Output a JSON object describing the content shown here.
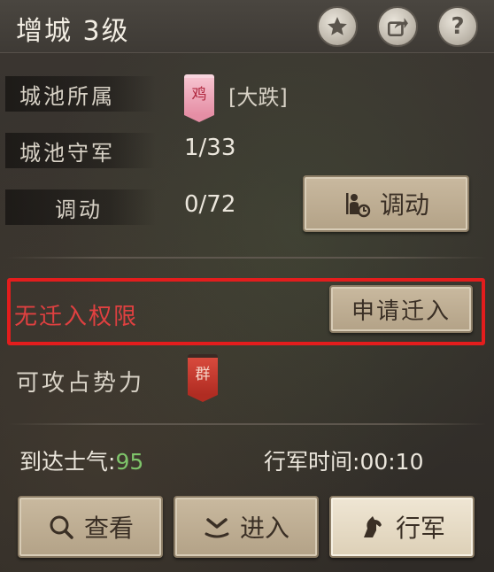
{
  "header": {
    "title": "增城  3级",
    "help_label": "?"
  },
  "rows": {
    "owner_label": "城池所属",
    "owner_flag": "鸡",
    "owner_name": "[大跌]",
    "garrison_label": "城池守军",
    "garrison_value": "1/33",
    "transfer_label": "调动",
    "transfer_value": "0/72",
    "transfer_button": "调动"
  },
  "permission": {
    "status": "无迁入权限",
    "apply_button": "申请迁入"
  },
  "attack": {
    "label": "可攻占势力",
    "flag": "群"
  },
  "stats": {
    "morale_label": "到达士气:",
    "morale_value": "95",
    "march_time_label": "行军时间:",
    "march_time_value": "00:10"
  },
  "actions": {
    "view": "查看",
    "enter": "进入",
    "march": "行军"
  },
  "colors": {
    "warning": "#e31d1d",
    "morale": "#7ec46a"
  }
}
